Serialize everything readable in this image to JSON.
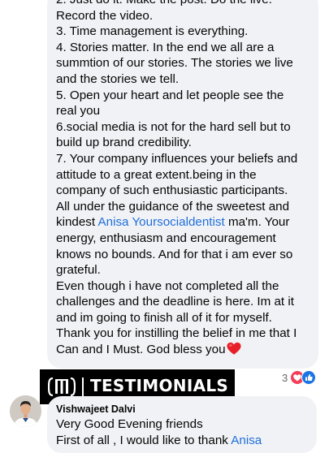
{
  "comment1": {
    "lines": [
      "2. Just do it. Make the post. Do the live.",
      "Record the video.",
      "3. Time management is everything.",
      "4. Stories matter. In the end we all are a",
      "summtion of our stories. The stories we live",
      "and the stories we tell.",
      "5. Open your heart and let people see the",
      "real you",
      "6.social media is not for the hard sell but to",
      "build up brand credibility.",
      "7. Your company influences your beliefs and",
      "attitude to a great extent.being in the",
      "company of such enthusiastic participants.",
      "All under the guidance of the sweetest and"
    ],
    "mention_prefix": "kindest ",
    "mention": "Anisa Yoursocialdentist",
    "mention_suffix": " ma'm. Your",
    "lines_after": [
      "energy, enthusiasm and encouragement",
      "knows no bounds. And for that i am ever so",
      "grateful.",
      "Even though i have not completed all the",
      "challenges and the deadline is here. Im at it",
      "and im going to finish all of it for myself.",
      "Thank you for instilling the belief in me that I"
    ],
    "last_line": "Can and I Must. God bless you",
    "reaction_count": "3"
  },
  "banner": {
    "label": "TESTIMONIALS"
  },
  "comment2": {
    "author": "Vishwajeet Dalvi",
    "line1": "Very Good Evening friends",
    "line2_prefix": "First of all , I would like to thank ",
    "line2_mention": "Anisa"
  },
  "colors": {
    "bubble": "#f0f2f5",
    "mention": "#216fdb",
    "love": "#f33e58",
    "like": "#1b74e4"
  },
  "icons": [
    "heart-emoji-icon",
    "love-reaction-icon",
    "like-reaction-icon",
    "brand-logo-icon",
    "user-avatar"
  ]
}
